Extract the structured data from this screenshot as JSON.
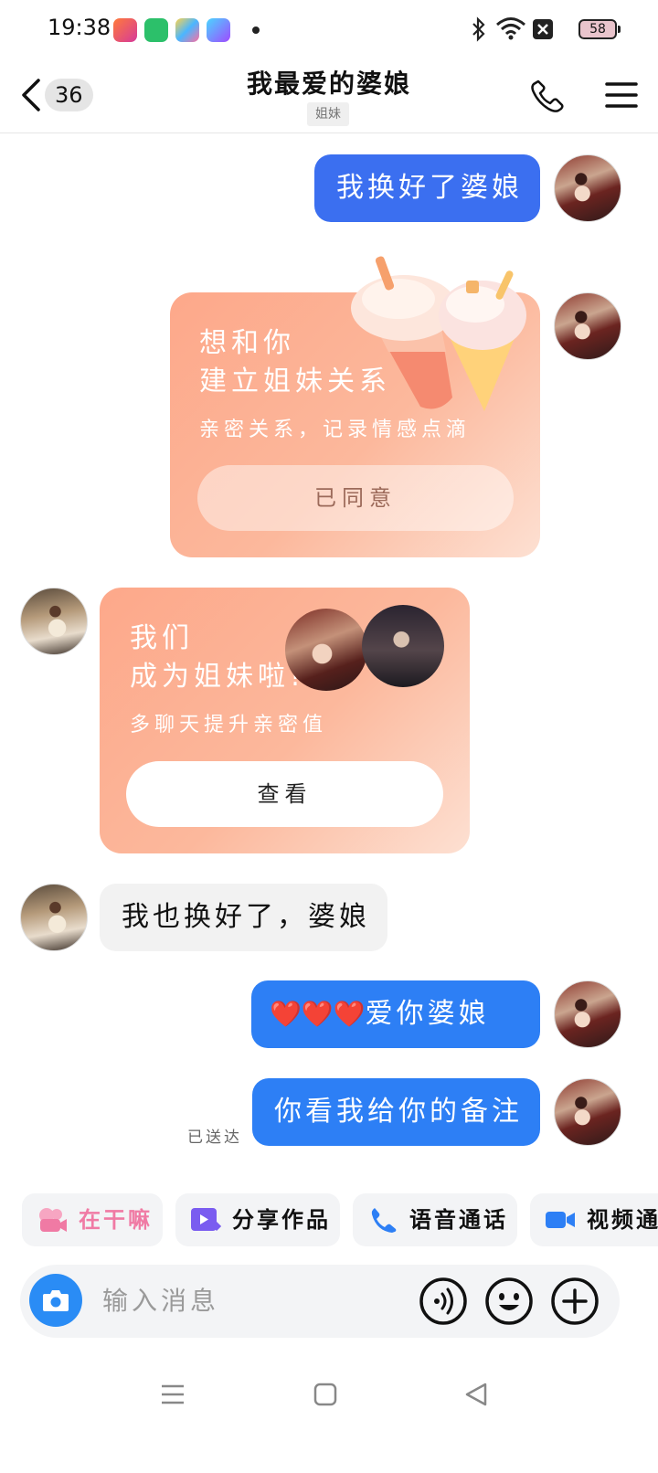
{
  "status_bar": {
    "time": "19:38",
    "battery": "58"
  },
  "header": {
    "back_count": "36",
    "title": "我最爱的婆娘",
    "tag": "姐妹"
  },
  "messages": {
    "m1": "我换好了婆娘",
    "card1": {
      "line1": "想和你",
      "line2": "建立姐妹关系",
      "sub": "亲密关系，记录情感点滴",
      "button": "已同意"
    },
    "card2": {
      "line1": "我们",
      "line2": "成为姐妹啦!",
      "sub": "多聊天提升亲密值",
      "button": "查看"
    },
    "m2": "我也换好了，婆娘",
    "m3_text": "爱你婆娘",
    "m3_emoji": "❤️❤️❤️",
    "m4": "你看我给你的备注",
    "delivered": "已送达"
  },
  "quick_actions": [
    {
      "label": "在干嘛",
      "icon": "camera-doodle-icon",
      "color": "#f07aa4"
    },
    {
      "label": "分享作品",
      "icon": "video-share-icon",
      "color": "#7a5cf0"
    },
    {
      "label": "语音通话",
      "icon": "phone-icon",
      "color": "#2d7ff5"
    },
    {
      "label": "视频通话",
      "icon": "video-camera-icon",
      "color": "#2d7ff5"
    }
  ],
  "input": {
    "placeholder": "输入消息"
  },
  "colors": {
    "outgoing": "#2d7ff5",
    "card": "#fcb89c",
    "accent_blue": "#2a8cf5"
  }
}
